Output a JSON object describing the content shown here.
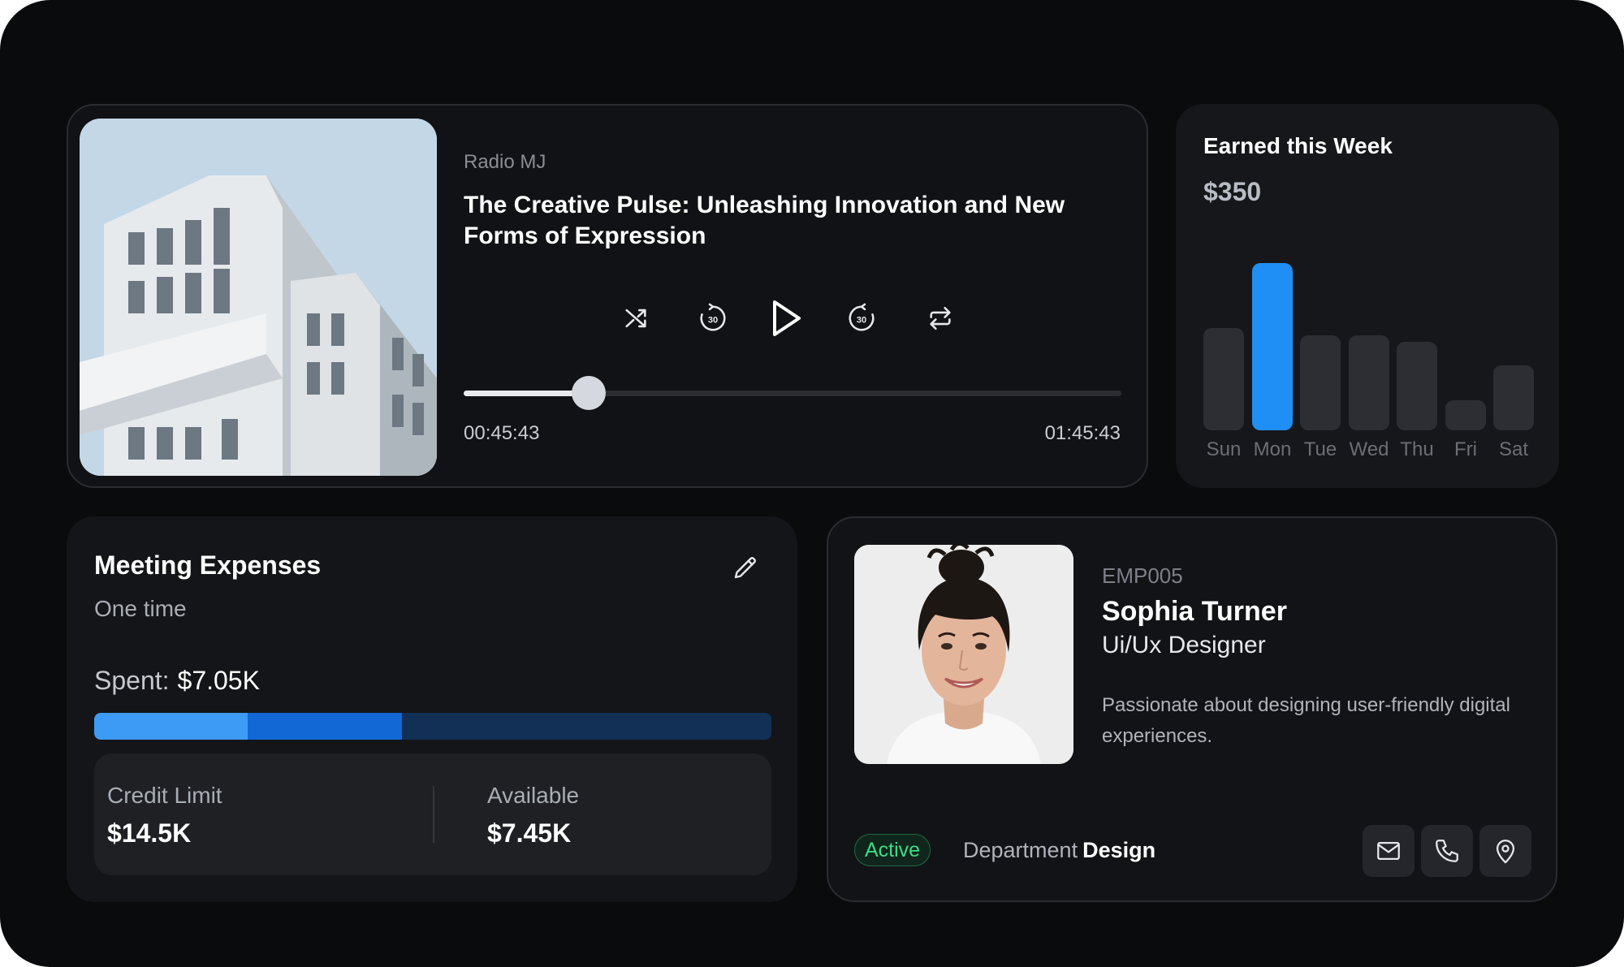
{
  "player": {
    "station": "Radio MJ",
    "episode_title": "The Creative Pulse: Unleashing Innovation and New Forms of Expression",
    "controls": [
      {
        "icon": "shuffle-icon"
      },
      {
        "icon": "rewind-30-icon"
      },
      {
        "icon": "play-icon"
      },
      {
        "icon": "forward-30-icon"
      },
      {
        "icon": "repeat-icon"
      }
    ],
    "current_time": "00:45:43",
    "total_time": "01:45:43",
    "progress": 0.19
  },
  "earnings": {
    "title": "Earned this Week",
    "amount": "$350"
  },
  "chart_data": {
    "type": "bar",
    "categories": [
      "Sun",
      "Mon",
      "Tue",
      "Wed",
      "Thu",
      "Fri",
      "Sat"
    ],
    "values": [
      0.61,
      1.0,
      0.57,
      0.57,
      0.53,
      0.18,
      0.39
    ],
    "highlight": "Mon",
    "colors": {
      "bar": "#2c2e33",
      "highlight": "#1f8ff5"
    }
  },
  "expenses": {
    "title": "Meeting Expenses",
    "subtitle": "One time",
    "spent_label": "Spent:",
    "spent_value": "$7.05K",
    "segments": [
      {
        "fraction": 0.227,
        "color": "#3d9bf5"
      },
      {
        "fraction": 0.228,
        "color": "#1268d4"
      },
      {
        "fraction": 0.545,
        "color": "#123056"
      }
    ],
    "credit_label": "Credit Limit",
    "credit_value": "$14.5K",
    "available_label": "Available",
    "available_value": "$7.45K"
  },
  "employee": {
    "id": "EMP005",
    "name": "Sophia Turner",
    "role": "Ui/Ux Designer",
    "bio": "Passionate about designing user-friendly digital experiences.",
    "status": "Active",
    "department_label": "Department",
    "department_value": "Design",
    "actions": [
      {
        "icon": "mail-icon"
      },
      {
        "icon": "phone-icon"
      },
      {
        "icon": "location-pin-icon"
      }
    ]
  }
}
